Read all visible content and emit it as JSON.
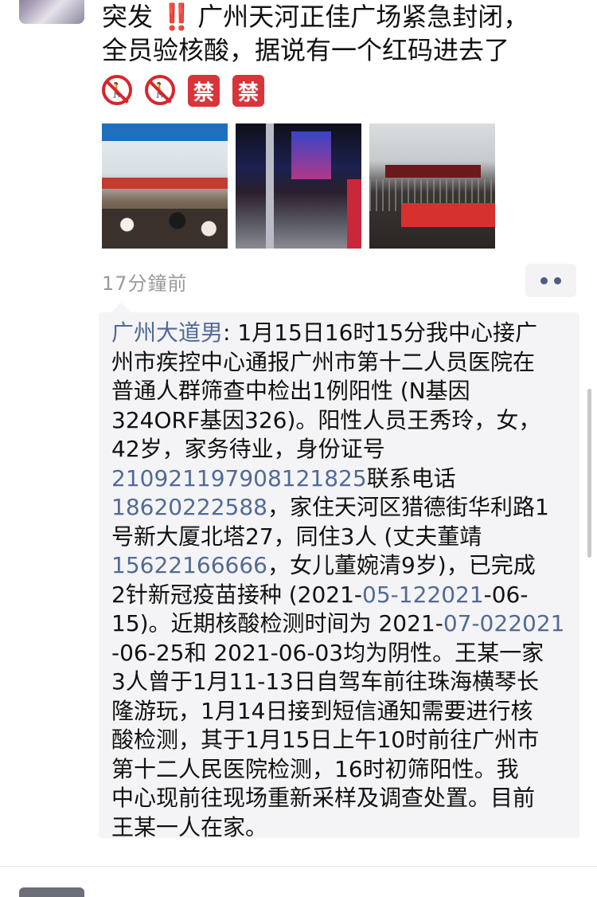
{
  "post": {
    "line1_a": "突发",
    "line1_bang": "‼️",
    "line1_b": "广州天河正佳广场紧急封闭，",
    "line2": "全员验核酸，据说有一个红码进去了",
    "emojis": [
      {
        "icon": "no-pedestrians-icon",
        "glyph": "🚶"
      },
      {
        "icon": "no-pedestrians-icon",
        "glyph": "🚶"
      },
      {
        "icon": "prohibited-sign-icon",
        "glyph": "禁"
      },
      {
        "icon": "prohibited-sign-icon",
        "glyph": "禁"
      }
    ],
    "photos": [
      "mall-entrance-crowd-photo",
      "night-street-barrier-photo",
      "closed-storefront-barrier-photo"
    ],
    "time": "17分鐘前",
    "more_button": "more-options-icon"
  },
  "comment": {
    "user": "广州大道男",
    "sep": ": ",
    "lines": [
      [
        {
          "t": "1月15日16时15分我中心接广"
        }
      ],
      [
        {
          "t": "州市疾控中心通报广州市第十二人员医院在"
        }
      ],
      [
        {
          "t": "普通人群筛查中检出1例阳性 (N基因"
        }
      ],
      [
        {
          "t": "324ORF基因326)。阳性人员王秀玲，女，"
        }
      ],
      [
        {
          "t": "42岁，家务待业，身份证号"
        }
      ],
      [
        {
          "t": "210921197908121825",
          "link": true
        },
        {
          "t": "联系电话"
        }
      ],
      [
        {
          "t": "18620222588",
          "link": true
        },
        {
          "t": "，家住天河区猎德街华利路1"
        }
      ],
      [
        {
          "t": "号新大厦北塔27，同住3人 (丈夫董靖"
        }
      ],
      [
        {
          "t": "15622166666",
          "link": true
        },
        {
          "t": "，女儿董婉清9岁)，已完成"
        }
      ],
      [
        {
          "t": "2针新冠疫苗接种 (2021-"
        },
        {
          "t": "05-122021",
          "link": true
        },
        {
          "t": "-06-"
        }
      ],
      [
        {
          "t": "15)。近期核酸检测时间为 2021-"
        },
        {
          "t": "07-022021",
          "link": true
        }
      ],
      [
        {
          "t": "-06-25和 2021-06-03均为阴性。王某一家"
        }
      ],
      [
        {
          "t": "3人曾于1月11-13日自驾车前往珠海横琴长"
        }
      ],
      [
        {
          "t": "隆游玩，1月14日接到短信通知需要进行核"
        }
      ],
      [
        {
          "t": "酸检测，其于1月15日上午10时前往广州市"
        }
      ],
      [
        {
          "t": "第十二人民医院检测，16时初筛阳性。我"
        }
      ],
      [
        {
          "t": "中心现前往现场重新采样及调查处置。目前"
        }
      ],
      [
        {
          "t": "王某一人在家。"
        }
      ]
    ]
  },
  "colors": {
    "link": "#526a95",
    "bang": "#e0262b",
    "ban": "#d8343a",
    "comment_bg": "#f4f4f6"
  }
}
